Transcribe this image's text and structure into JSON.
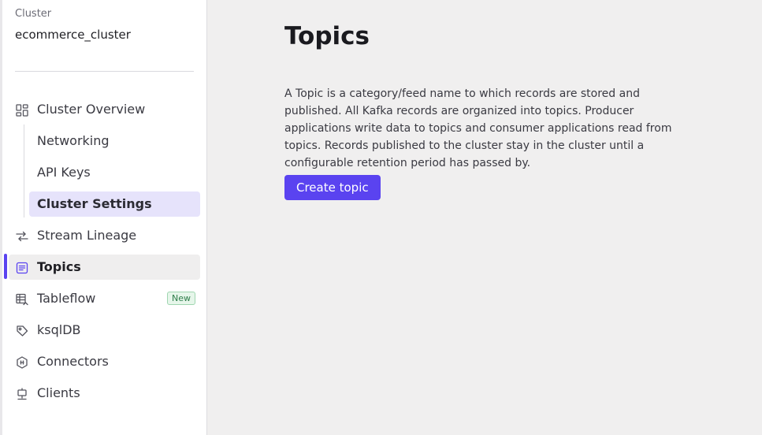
{
  "sidebar": {
    "cluster_label": "Cluster",
    "cluster_name": "ecommerce_cluster",
    "items": [
      {
        "label": "Cluster Overview",
        "icon": "dashboard-icon"
      },
      {
        "label": "Stream Lineage",
        "icon": "lineage-icon"
      },
      {
        "label": "Topics",
        "icon": "topics-icon",
        "active": true
      },
      {
        "label": "Tableflow",
        "icon": "tableflow-icon",
        "badge": "New"
      },
      {
        "label": "ksqlDB",
        "icon": "ksqldb-icon"
      },
      {
        "label": "Connectors",
        "icon": "connectors-icon"
      },
      {
        "label": "Clients",
        "icon": "clients-icon"
      }
    ],
    "sub_items": [
      {
        "label": "Networking"
      },
      {
        "label": "API Keys"
      },
      {
        "label": "Cluster Settings",
        "active": true
      }
    ]
  },
  "main": {
    "title": "Topics",
    "description": "A Topic is a category/feed name to which records are stored and published. All Kafka records are organized into topics. Producer applications write data to topics and consumer applications read from topics. Records published to the cluster stay in the cluster until a configurable retention period has passed by.",
    "create_button": "Create topic"
  },
  "colors": {
    "accent": "#5a43f0",
    "active_sub_bg": "#e6e3fb",
    "badge_green": "#2e7d4a"
  }
}
